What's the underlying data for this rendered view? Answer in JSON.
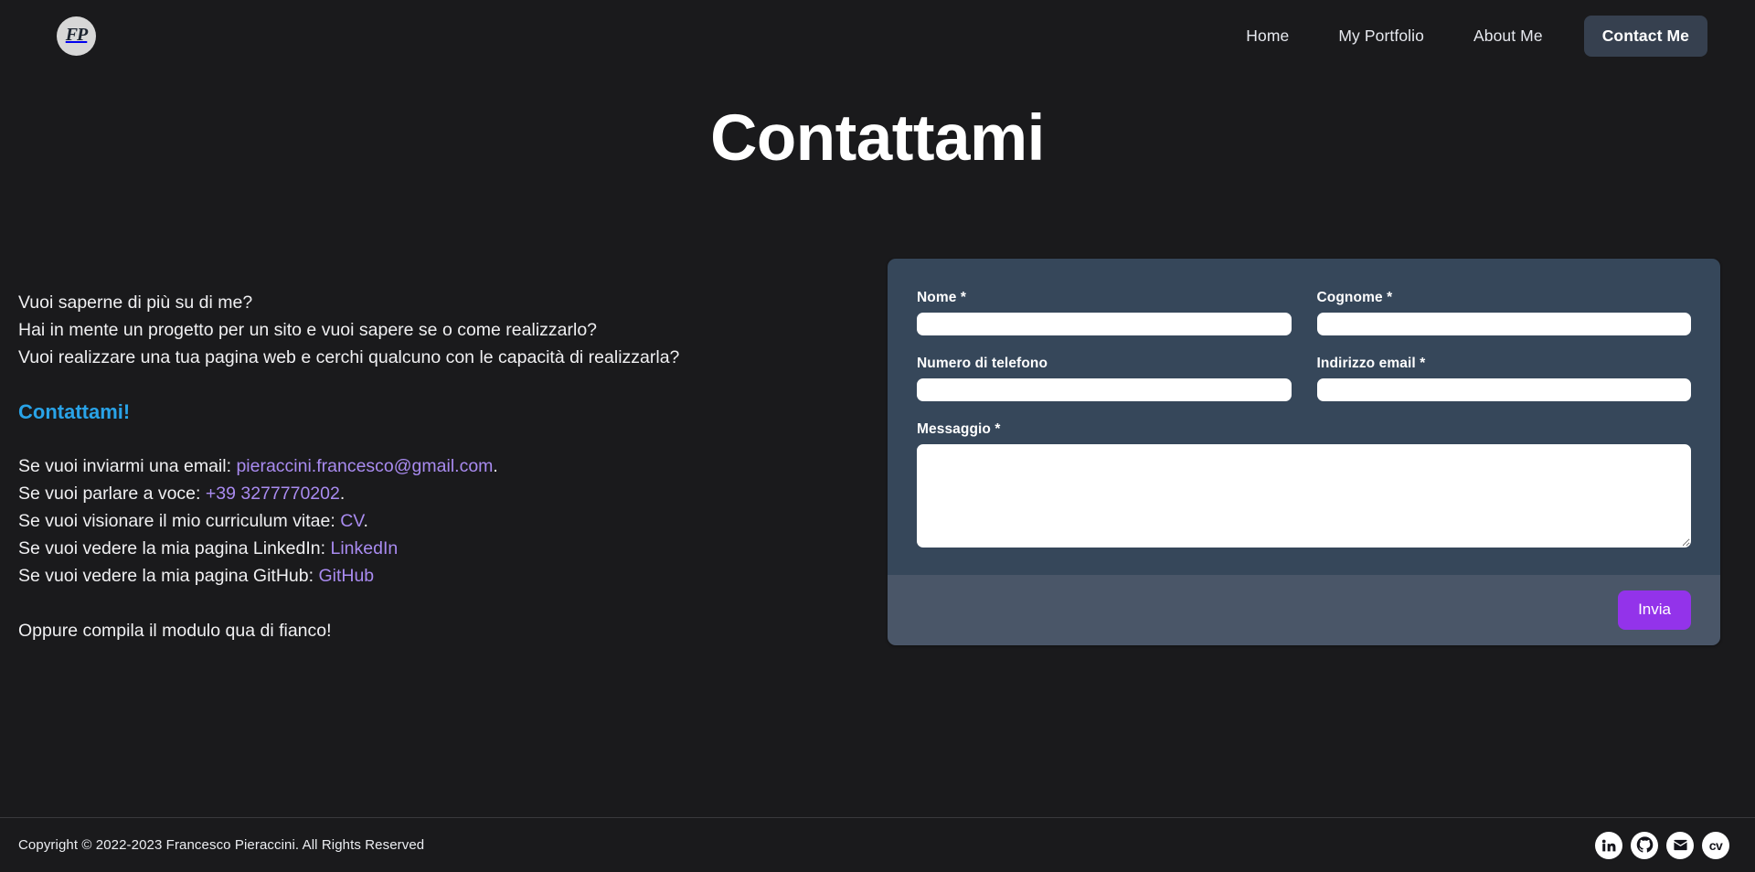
{
  "brand": {
    "logo_text": "FP",
    "logo_icon": "fp-monogram-icon"
  },
  "nav": {
    "items": [
      {
        "label": "Home",
        "name": "nav-link-home",
        "cta": false
      },
      {
        "label": "My Portfolio",
        "name": "nav-link-my-portfolio",
        "cta": false
      },
      {
        "label": "About Me",
        "name": "nav-link-about-me",
        "cta": false
      },
      {
        "label": "Contact Me",
        "name": "nav-link-contact-me",
        "cta": true
      }
    ],
    "home": "Home",
    "portfolio": "My Portfolio",
    "about": "About Me",
    "contact": "Contact Me"
  },
  "page": {
    "title": "Contattami"
  },
  "intro": {
    "line1": "Vuoi saperne di più su di me?",
    "line2": "Hai in mente un progetto per un sito e vuoi sapere se o come realizzarlo?",
    "line3": "Vuoi realizzare una tua pagina web e cerchi qualcuno con le capacità di realizzarla?",
    "heading": "Contattami!",
    "closing": "Oppure compila il modulo qua di fianco!"
  },
  "contacts": {
    "email_prefix": "Se vuoi inviarmi una email: ",
    "email_value": "pieraccini.francesco@gmail.com",
    "email_suffix": ".",
    "phone_prefix": "Se vuoi parlare a voce: ",
    "phone_value": "+39 3277770202",
    "phone_suffix": ".",
    "cv_prefix": "Se vuoi visionare il mio curriculum vitae: ",
    "cv_value": "CV",
    "cv_suffix": ".",
    "linkedin_prefix": "Se vuoi vedere la mia pagina LinkedIn: ",
    "linkedin_value": "LinkedIn",
    "github_prefix": "Se vuoi vedere la mia pagina GitHub: ",
    "github_value": "GitHub"
  },
  "form": {
    "first_name": {
      "label": "Nome *",
      "value": "",
      "placeholder": ""
    },
    "last_name": {
      "label": "Cognome *",
      "value": "",
      "placeholder": ""
    },
    "phone": {
      "label": "Numero di telefono",
      "value": "",
      "placeholder": ""
    },
    "email": {
      "label": "Indirizzo email *",
      "value": "",
      "placeholder": ""
    },
    "message": {
      "label": "Messaggio *",
      "value": "",
      "placeholder": ""
    },
    "submit_label": "Invia"
  },
  "footer": {
    "copyright": "Copyright © 2022-2023 Francesco Pieraccini. All Rights Reserved",
    "social": [
      {
        "name": "linkedin-icon",
        "label": "LinkedIn"
      },
      {
        "name": "github-icon",
        "label": "GitHub"
      },
      {
        "name": "email-icon",
        "label": "Email"
      },
      {
        "name": "cv-icon",
        "label": "CV"
      }
    ],
    "cv_glyph": "cv"
  },
  "colors": {
    "page_background": "#1a1a1c",
    "accent_blue": "#29a3e8",
    "link_purple": "#a98bf0",
    "card_body": "#36475a",
    "card_footer": "#4a5668",
    "submit_purple": "#9333ea",
    "nav_cta": "#36404f"
  }
}
